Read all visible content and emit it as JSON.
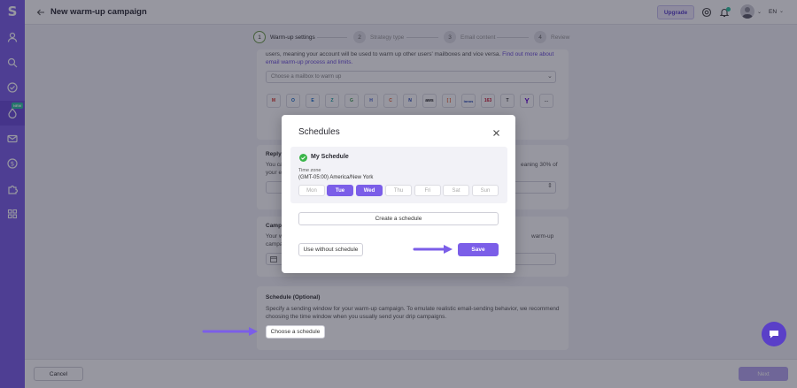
{
  "header": {
    "title": "New warm-up campaign",
    "upgrade_label": "Upgrade",
    "language": "EN"
  },
  "stepper": {
    "steps": [
      {
        "number": "1",
        "label": "Warm-up settings"
      },
      {
        "number": "2",
        "label": "Strategy type"
      },
      {
        "number": "3",
        "label": "Email content"
      },
      {
        "number": "4",
        "label": "Review"
      }
    ]
  },
  "sidebar": {
    "new_badge": "NEW",
    "items": [
      "user-icon",
      "search-icon",
      "check-circle-icon",
      "warmup-icon",
      "mail-icon",
      "dollar-icon",
      "puzzle-icon",
      "apps-icon"
    ]
  },
  "mailbox": {
    "text": "users, meaning your account will be used to warm up other users' mailboxes and vice versa.",
    "link": "Find out more about email warm-up process and limits.",
    "select_placeholder": "Choose a mailbox to warm up",
    "providers": [
      "M",
      "O",
      "E",
      "Z",
      "G",
      "H",
      "C",
      "N",
      "aws",
      "[ ]",
      "ionos",
      "163",
      "T",
      "Y",
      "..."
    ]
  },
  "reply": {
    "title": "Reply",
    "text_start": "You ca",
    "text_end": "eaning 30% of",
    "text_line2": "your e"
  },
  "campaign": {
    "title": "Camp",
    "text_start": "Your w",
    "text_end": "warm-up",
    "text_line2": "campa"
  },
  "schedule_card": {
    "title": "Schedule (Optional)",
    "text1": "Specify a sending window for your warm-up campaign. To emulate realistic email-sending behavior, we recommend",
    "text2": "choosing the time window when you usually send your drip campaigns.",
    "choose_label": "Choose a schedule"
  },
  "footer": {
    "cancel_label": "Cancel",
    "next_label": "Next"
  },
  "modal": {
    "title": "Schedules",
    "schedule_name": "My Schedule",
    "timezone_label": "Time zone",
    "timezone_value": "(GMT-05:00) America/New York",
    "days": [
      {
        "label": "Mon",
        "selected": false
      },
      {
        "label": "Tue",
        "selected": true
      },
      {
        "label": "Wed",
        "selected": true
      },
      {
        "label": "Thu",
        "selected": false
      },
      {
        "label": "Fri",
        "selected": false
      },
      {
        "label": "Sat",
        "selected": false
      },
      {
        "label": "Sun",
        "selected": false
      }
    ],
    "create_label": "Create a schedule",
    "use_without_label": "Use without schedule",
    "save_label": "Save"
  },
  "colors": {
    "accent": "#7b5ee8",
    "sidebar": "#7b5ee8",
    "success": "#2ec4a0"
  }
}
